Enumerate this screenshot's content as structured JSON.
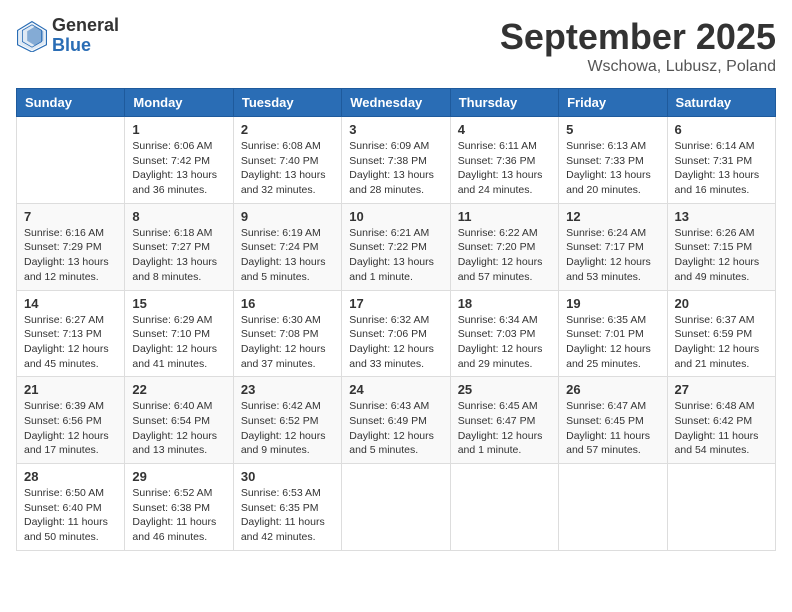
{
  "logo": {
    "general": "General",
    "blue": "Blue"
  },
  "title": "September 2025",
  "location": "Wschowa, Lubusz, Poland",
  "days_of_week": [
    "Sunday",
    "Monday",
    "Tuesday",
    "Wednesday",
    "Thursday",
    "Friday",
    "Saturday"
  ],
  "weeks": [
    [
      {
        "day": "",
        "info": ""
      },
      {
        "day": "1",
        "info": "Sunrise: 6:06 AM\nSunset: 7:42 PM\nDaylight: 13 hours\nand 36 minutes."
      },
      {
        "day": "2",
        "info": "Sunrise: 6:08 AM\nSunset: 7:40 PM\nDaylight: 13 hours\nand 32 minutes."
      },
      {
        "day": "3",
        "info": "Sunrise: 6:09 AM\nSunset: 7:38 PM\nDaylight: 13 hours\nand 28 minutes."
      },
      {
        "day": "4",
        "info": "Sunrise: 6:11 AM\nSunset: 7:36 PM\nDaylight: 13 hours\nand 24 minutes."
      },
      {
        "day": "5",
        "info": "Sunrise: 6:13 AM\nSunset: 7:33 PM\nDaylight: 13 hours\nand 20 minutes."
      },
      {
        "day": "6",
        "info": "Sunrise: 6:14 AM\nSunset: 7:31 PM\nDaylight: 13 hours\nand 16 minutes."
      }
    ],
    [
      {
        "day": "7",
        "info": "Sunrise: 6:16 AM\nSunset: 7:29 PM\nDaylight: 13 hours\nand 12 minutes."
      },
      {
        "day": "8",
        "info": "Sunrise: 6:18 AM\nSunset: 7:27 PM\nDaylight: 13 hours\nand 8 minutes."
      },
      {
        "day": "9",
        "info": "Sunrise: 6:19 AM\nSunset: 7:24 PM\nDaylight: 13 hours\nand 5 minutes."
      },
      {
        "day": "10",
        "info": "Sunrise: 6:21 AM\nSunset: 7:22 PM\nDaylight: 13 hours\nand 1 minute."
      },
      {
        "day": "11",
        "info": "Sunrise: 6:22 AM\nSunset: 7:20 PM\nDaylight: 12 hours\nand 57 minutes."
      },
      {
        "day": "12",
        "info": "Sunrise: 6:24 AM\nSunset: 7:17 PM\nDaylight: 12 hours\nand 53 minutes."
      },
      {
        "day": "13",
        "info": "Sunrise: 6:26 AM\nSunset: 7:15 PM\nDaylight: 12 hours\nand 49 minutes."
      }
    ],
    [
      {
        "day": "14",
        "info": "Sunrise: 6:27 AM\nSunset: 7:13 PM\nDaylight: 12 hours\nand 45 minutes."
      },
      {
        "day": "15",
        "info": "Sunrise: 6:29 AM\nSunset: 7:10 PM\nDaylight: 12 hours\nand 41 minutes."
      },
      {
        "day": "16",
        "info": "Sunrise: 6:30 AM\nSunset: 7:08 PM\nDaylight: 12 hours\nand 37 minutes."
      },
      {
        "day": "17",
        "info": "Sunrise: 6:32 AM\nSunset: 7:06 PM\nDaylight: 12 hours\nand 33 minutes."
      },
      {
        "day": "18",
        "info": "Sunrise: 6:34 AM\nSunset: 7:03 PM\nDaylight: 12 hours\nand 29 minutes."
      },
      {
        "day": "19",
        "info": "Sunrise: 6:35 AM\nSunset: 7:01 PM\nDaylight: 12 hours\nand 25 minutes."
      },
      {
        "day": "20",
        "info": "Sunrise: 6:37 AM\nSunset: 6:59 PM\nDaylight: 12 hours\nand 21 minutes."
      }
    ],
    [
      {
        "day": "21",
        "info": "Sunrise: 6:39 AM\nSunset: 6:56 PM\nDaylight: 12 hours\nand 17 minutes."
      },
      {
        "day": "22",
        "info": "Sunrise: 6:40 AM\nSunset: 6:54 PM\nDaylight: 12 hours\nand 13 minutes."
      },
      {
        "day": "23",
        "info": "Sunrise: 6:42 AM\nSunset: 6:52 PM\nDaylight: 12 hours\nand 9 minutes."
      },
      {
        "day": "24",
        "info": "Sunrise: 6:43 AM\nSunset: 6:49 PM\nDaylight: 12 hours\nand 5 minutes."
      },
      {
        "day": "25",
        "info": "Sunrise: 6:45 AM\nSunset: 6:47 PM\nDaylight: 12 hours\nand 1 minute."
      },
      {
        "day": "26",
        "info": "Sunrise: 6:47 AM\nSunset: 6:45 PM\nDaylight: 11 hours\nand 57 minutes."
      },
      {
        "day": "27",
        "info": "Sunrise: 6:48 AM\nSunset: 6:42 PM\nDaylight: 11 hours\nand 54 minutes."
      }
    ],
    [
      {
        "day": "28",
        "info": "Sunrise: 6:50 AM\nSunset: 6:40 PM\nDaylight: 11 hours\nand 50 minutes."
      },
      {
        "day": "29",
        "info": "Sunrise: 6:52 AM\nSunset: 6:38 PM\nDaylight: 11 hours\nand 46 minutes."
      },
      {
        "day": "30",
        "info": "Sunrise: 6:53 AM\nSunset: 6:35 PM\nDaylight: 11 hours\nand 42 minutes."
      },
      {
        "day": "",
        "info": ""
      },
      {
        "day": "",
        "info": ""
      },
      {
        "day": "",
        "info": ""
      },
      {
        "day": "",
        "info": ""
      }
    ]
  ]
}
